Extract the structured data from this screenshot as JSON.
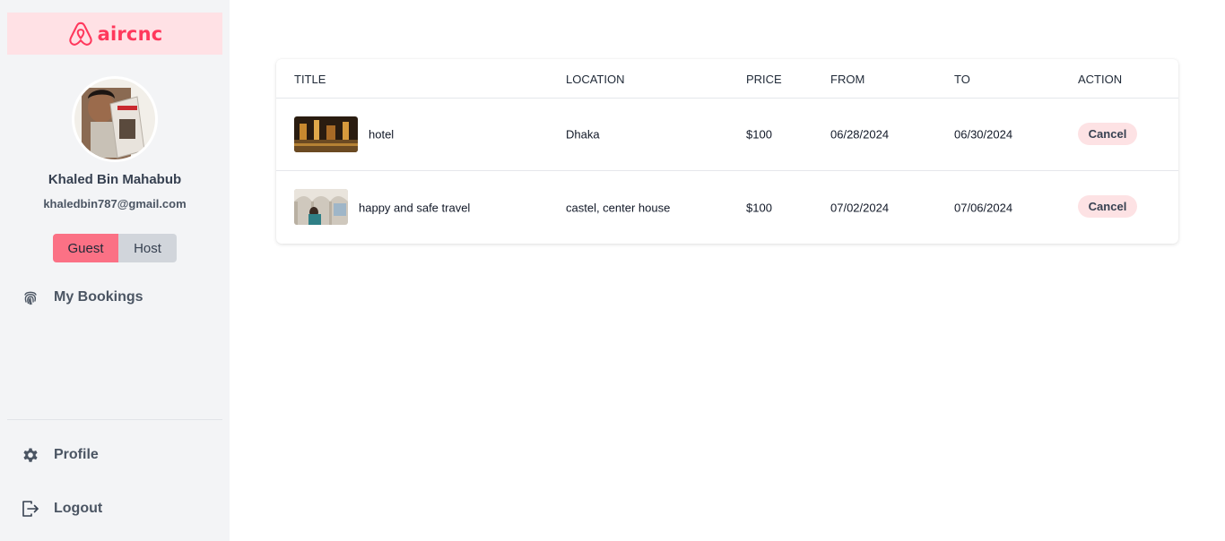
{
  "brand": {
    "name": "aircnc",
    "color": "#ff385c"
  },
  "user": {
    "name": "Khaled Bin Mahabub",
    "email": "khaledbin787@gmail.com"
  },
  "role_toggle": {
    "guest_label": "Guest",
    "host_label": "Host",
    "selected": "Guest"
  },
  "nav": {
    "my_bookings": {
      "label": "My Bookings",
      "icon": "fingerprint-icon"
    },
    "profile": {
      "label": "Profile",
      "icon": "gear-icon"
    },
    "logout": {
      "label": "Logout",
      "icon": "logout-icon"
    }
  },
  "table": {
    "headers": {
      "title": "TITLE",
      "location": "LOCATION",
      "price": "PRICE",
      "from": "FROM",
      "to": "TO",
      "action": "ACTION"
    },
    "rows": [
      {
        "title": "hotel",
        "location": "Dhaka",
        "price": "$100",
        "from": "06/28/2024",
        "to": "06/30/2024",
        "action": "Cancel"
      },
      {
        "title": "happy and safe travel",
        "location": "castel, center house",
        "price": "$100",
        "from": "07/02/2024",
        "to": "07/06/2024",
        "action": "Cancel"
      }
    ]
  }
}
